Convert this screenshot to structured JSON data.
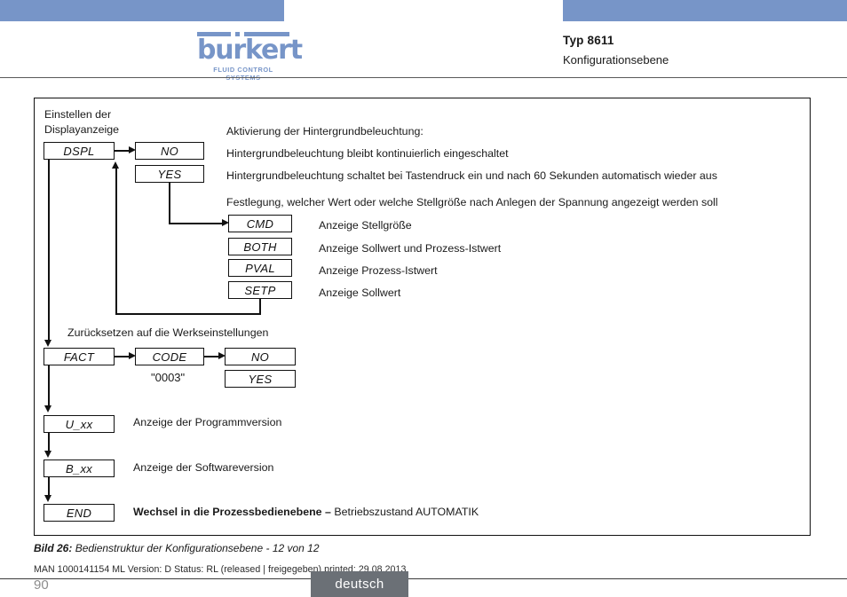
{
  "header": {
    "brand": "burkert",
    "brand_sub": "FLUID CONTROL SYSTEMS",
    "title": "Typ 8611",
    "subtitle": "Konfigurationsebene",
    "accent_color": "#7795c8"
  },
  "diagram": {
    "intro_line1": "Einstellen der",
    "intro_line2": "Displayanzeige",
    "reset_label": "Zurücksetzen auf die Werkseinstellungen",
    "code_value": "\"0003\"",
    "boxes": {
      "dspl": "DSPL",
      "no1": "NO",
      "yes1": "YES",
      "cmd": "CMD",
      "both": "BOTH",
      "pval": "PVAL",
      "setp": "SETP",
      "fact": "FACT",
      "code": "CODE",
      "no2": "NO",
      "yes2": "YES",
      "uxx": "U_xx",
      "bxx": "B_xx",
      "end": "END"
    },
    "descriptions": {
      "activation": "Aktivierung der Hintergrundbeleuchtung:",
      "no_desc": "Hintergrundbeleuchtung bleibt kontinuierlich eingeschaltet",
      "yes_desc": "Hintergrundbeleuchtung schaltet bei Tastendruck ein und nach 60 Sekunden automatisch wieder aus",
      "festlegung": "Festlegung, welcher Wert oder welche Stellgröße nach Anlegen der Spannung angezeigt werden soll",
      "cmd_desc": "Anzeige Stellgröße",
      "both_desc": "Anzeige Sollwert und Prozess-Istwert",
      "pval_desc": "Anzeige Prozess-Istwert",
      "setp_desc": "Anzeige Sollwert",
      "uxx_desc": "Anzeige der Programmversion",
      "bxx_desc": "Anzeige der Softwareversion",
      "end_desc_bold": "Wechsel in die Prozessbedienebene – ",
      "end_desc_rest": "Betriebszustand AUTOMATIK"
    }
  },
  "caption": {
    "number": "Bild 26:",
    "text": "Bedienstruktur der Konfigurationsebene - 12 von 12"
  },
  "footer": {
    "meta": "MAN 1000141154 ML  Version: D Status: RL (released | freigegeben)  printed: 29.08.2013",
    "page_number": "90",
    "language": "deutsch"
  }
}
